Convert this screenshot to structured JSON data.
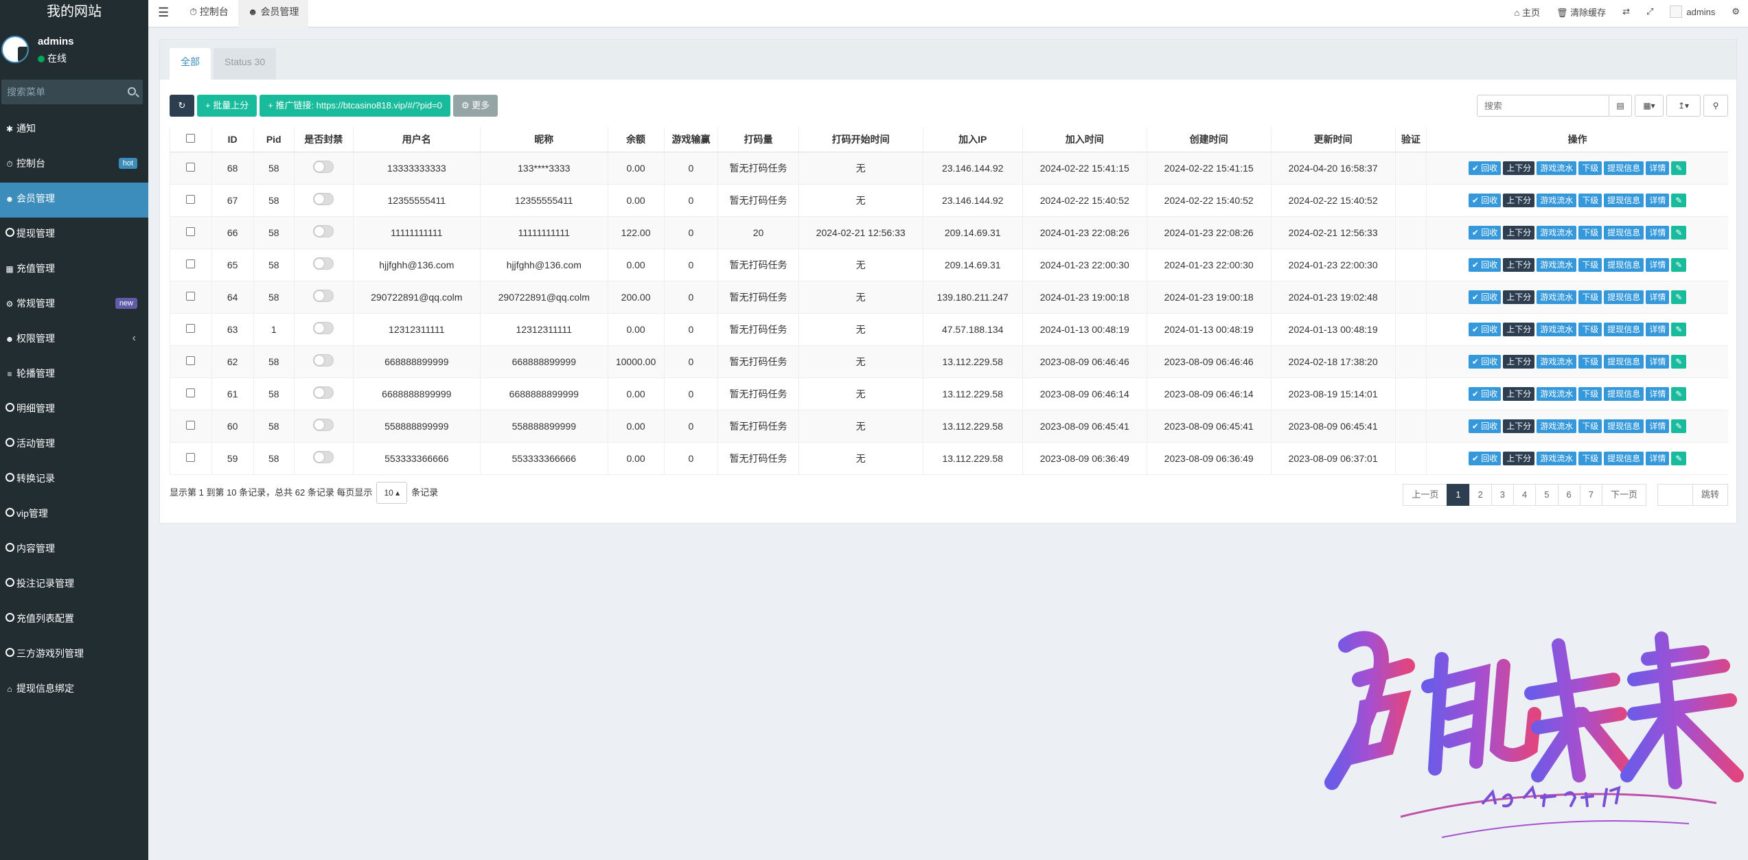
{
  "site": {
    "title": "我的网站"
  },
  "user": {
    "name": "admins",
    "status": "在线"
  },
  "sidebar_search": {
    "placeholder": "搜索菜单"
  },
  "menu": [
    {
      "label": "通知",
      "icon": "gear-icon"
    },
    {
      "label": "控制台",
      "icon": "dashboard-icon",
      "badge": "hot"
    },
    {
      "label": "会员管理",
      "icon": "users-icon",
      "active": true
    },
    {
      "label": "提现管理",
      "icon": "circle-icon"
    },
    {
      "label": "充值管理",
      "icon": "grid-icon"
    },
    {
      "label": "常规管理",
      "icon": "cogs-icon",
      "badge": "new"
    },
    {
      "label": "权限管理",
      "icon": "users-icon"
    },
    {
      "label": "轮播管理",
      "icon": "list-icon"
    },
    {
      "label": "明细管理",
      "icon": "circle-icon"
    },
    {
      "label": "活动管理",
      "icon": "circle-icon"
    },
    {
      "label": "转换记录",
      "icon": "circle-icon"
    },
    {
      "label": "vip管理",
      "icon": "circle-icon"
    },
    {
      "label": "内容管理",
      "icon": "circle-icon"
    },
    {
      "label": "投注记录管理",
      "icon": "circle-icon"
    },
    {
      "label": "充值列表配置",
      "icon": "circle-icon"
    },
    {
      "label": "三方游戏列管理",
      "icon": "circle-icon"
    },
    {
      "label": "提现信息绑定",
      "icon": "bank-icon"
    }
  ],
  "topbar": {
    "tab_dashboard": "控制台",
    "tab_members": "会员管理",
    "home": "主页",
    "clear_cache": "清除缓存",
    "user": "admins"
  },
  "panel_tabs": [
    "全部",
    "Status 30"
  ],
  "toolbar": {
    "batch": "批量上分",
    "promo": "推广链接: https://btcasino818.vip/#/?pid=0",
    "more": "更多",
    "search_placeholder": "搜索"
  },
  "table": {
    "headers": [
      "ID",
      "Pid",
      "是否封禁",
      "用户名",
      "昵称",
      "余额",
      "游戏输赢",
      "打码量",
      "打码开始时间",
      "加入IP",
      "加入时间",
      "创建时间",
      "更新时间",
      "验证",
      "操作"
    ],
    "ops": [
      "回收",
      "上下分",
      "游戏流水",
      "下级",
      "提现信息",
      "详情"
    ],
    "rows": [
      [
        "68",
        "58",
        "13333333333",
        "133****3333",
        "0.00",
        "0",
        "暂无打码任务",
        "无",
        "23.146.144.92",
        "2024-02-22 15:41:15",
        "2024-02-22 15:41:15",
        "2024-04-20 16:58:37"
      ],
      [
        "67",
        "58",
        "12355555411",
        "12355555411",
        "0.00",
        "0",
        "暂无打码任务",
        "无",
        "23.146.144.92",
        "2024-02-22 15:40:52",
        "2024-02-22 15:40:52",
        "2024-02-22 15:40:52"
      ],
      [
        "66",
        "58",
        "11111111111",
        "11111111111",
        "122.00",
        "0",
        "20",
        "2024-02-21 12:56:33",
        "209.14.69.31",
        "2024-01-23 22:08:26",
        "2024-01-23 22:08:26",
        "2024-02-21 12:56:33"
      ],
      [
        "65",
        "58",
        "hjjfghh@136.com",
        "hjjfghh@136.com",
        "0.00",
        "0",
        "暂无打码任务",
        "无",
        "209.14.69.31",
        "2024-01-23 22:00:30",
        "2024-01-23 22:00:30",
        "2024-01-23 22:00:30"
      ],
      [
        "64",
        "58",
        "290722891@qq.colm",
        "290722891@qq.colm",
        "200.00",
        "0",
        "暂无打码任务",
        "无",
        "139.180.211.247",
        "2024-01-23 19:00:18",
        "2024-01-23 19:00:18",
        "2024-01-23 19:02:48"
      ],
      [
        "63",
        "1",
        "12312311111",
        "12312311111",
        "0.00",
        "0",
        "暂无打码任务",
        "无",
        "47.57.188.134",
        "2024-01-13 00:48:19",
        "2024-01-13 00:48:19",
        "2024-01-13 00:48:19"
      ],
      [
        "62",
        "58",
        "668888899999",
        "668888899999",
        "10000.00",
        "0",
        "暂无打码任务",
        "无",
        "13.112.229.58",
        "2023-08-09 06:46:46",
        "2023-08-09 06:46:46",
        "2024-02-18 17:38:20"
      ],
      [
        "61",
        "58",
        "6688888899999",
        "6688888899999",
        "0.00",
        "0",
        "暂无打码任务",
        "无",
        "13.112.229.58",
        "2023-08-09 06:46:14",
        "2023-08-09 06:46:14",
        "2023-08-19 15:14:01"
      ],
      [
        "60",
        "58",
        "558888899999",
        "558888899999",
        "0.00",
        "0",
        "暂无打码任务",
        "无",
        "13.112.229.58",
        "2023-08-09 06:45:41",
        "2023-08-09 06:45:41",
        "2023-08-09 06:45:41"
      ],
      [
        "59",
        "58",
        "553333366666",
        "553333366666",
        "0.00",
        "0",
        "暂无打码任务",
        "无",
        "13.112.229.58",
        "2023-08-09 06:36:49",
        "2023-08-09 06:36:49",
        "2023-08-09 06:37:01"
      ]
    ]
  },
  "footer": {
    "summary": "显示第 1 到第 10 条记录，总共 62 条记录 每页显示",
    "page_size": "10",
    "suffix": "条记录"
  },
  "pagination": {
    "prev": "上一页",
    "pages": [
      "1",
      "2",
      "3",
      "4",
      "5",
      "6",
      "7"
    ],
    "current": "1",
    "next": "下一页",
    "jump": "跳转"
  },
  "watermark": {
    "main": "启航未来",
    "sub": "2024加油!"
  }
}
